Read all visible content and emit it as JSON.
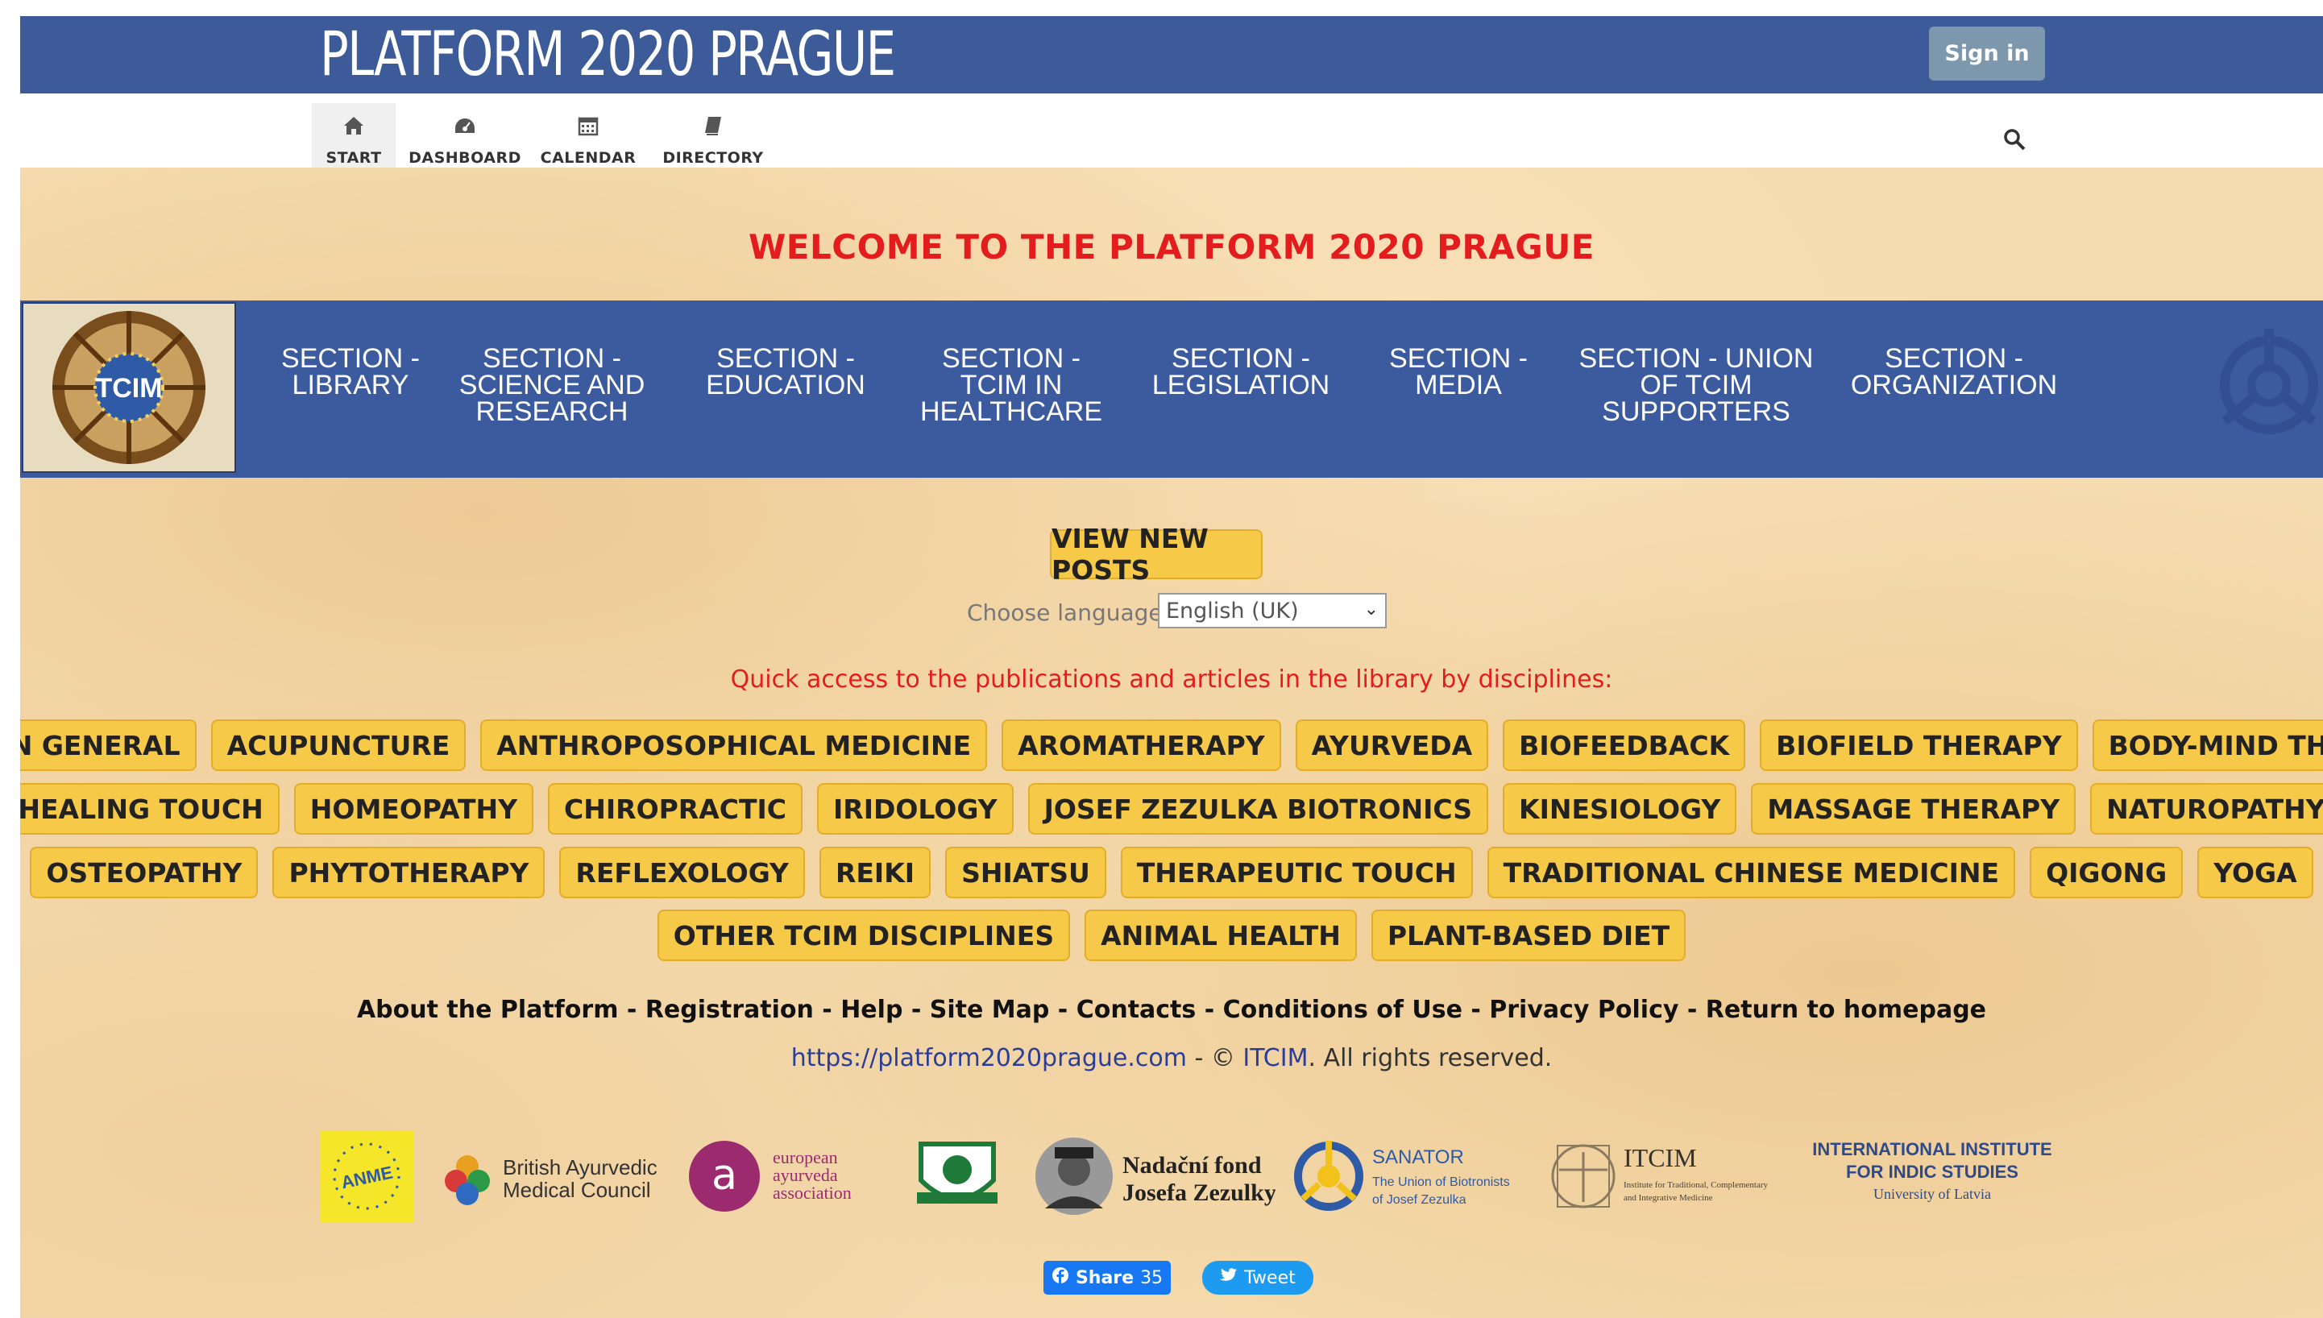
{
  "header": {
    "site_title": "PLATFORM 2020 PRAGUE",
    "signin_label": "Sign in"
  },
  "nav": {
    "items": [
      {
        "label": "START",
        "icon": "home-icon"
      },
      {
        "label": "DASHBOARD",
        "icon": "dashboard-icon"
      },
      {
        "label": "CALENDAR",
        "icon": "calendar-icon"
      },
      {
        "label": "DIRECTORY",
        "icon": "book-icon"
      }
    ],
    "active": "START"
  },
  "welcome": "WELCOME TO THE PLATFORM 2020 PRAGUE",
  "sections": [
    {
      "label": "SECTION - LIBRARY"
    },
    {
      "label": "SECTION - SCIENCE AND RESEARCH"
    },
    {
      "label": "SECTION - EDUCATION"
    },
    {
      "label": "SECTION - TCIM IN HEALTHCARE"
    },
    {
      "label": "SECTION - LEGISLATION"
    },
    {
      "label": "SECTION - MEDIA"
    },
    {
      "label": "SECTION - UNION OF TCIM SUPPORTERS"
    },
    {
      "label": "SECTION - ORGANIZATION"
    }
  ],
  "logo_text": "TCIM",
  "view_new_posts": "VIEW NEW POSTS",
  "language": {
    "label": "Choose language:",
    "selected": "English (UK)"
  },
  "quick_access": "Quick access to the publications and articles in the library by disciplines:",
  "disciplines": {
    "row1": [
      "TCIM IN GENERAL",
      "ACUPUNCTURE",
      "ANTHROPOSOPHICAL MEDICINE",
      "AROMATHERAPY",
      "AYURVEDA",
      "BIOFEEDBACK",
      "BIOFIELD THERAPY",
      "BODY-MIND THERAPY"
    ],
    "row2": [
      "HEALING TOUCH",
      "HOMEOPATHY",
      "CHIROPRACTIC",
      "IRIDOLOGY",
      "JOSEF ZEZULKA BIOTRONICS",
      "KINESIOLOGY",
      "MASSAGE THERAPY",
      "NATUROPATHY"
    ],
    "row3": [
      "OSTEOPATHY",
      "PHYTOTHERAPY",
      "REFLEXOLOGY",
      "REIKI",
      "SHIATSU",
      "THERAPEUTIC TOUCH",
      "TRADITIONAL CHINESE MEDICINE",
      "QIGONG",
      "YOGA"
    ],
    "row4": [
      "OTHER TCIM DISCIPLINES",
      "ANIMAL HEALTH",
      "PLANT-BASED DIET"
    ]
  },
  "footer": {
    "links": [
      "About the Platform",
      "Registration",
      "Help",
      "Site Map",
      "Contacts",
      "Conditions of Use",
      "Privacy Policy",
      "Return to homepage"
    ],
    "url": "https://platform2020prague.com",
    "copy_sep": " - © ",
    "org": "ITCIM",
    "rights": ". All rights reserved."
  },
  "partners": {
    "anme": "ANME",
    "bamc_1": "British Ayurvedic",
    "bamc_2": "Medical Council",
    "eaa_1": "european",
    "eaa_2": "ayurveda",
    "eaa_3": "association",
    "nf_1": "Nadační fond",
    "nf_2": "Josefa Zezulky",
    "sanator_1": "SANATOR",
    "sanator_2": "The Union of Biotronists",
    "sanator_3": "of Josef Zezulka",
    "itcim_1": "ITCIM",
    "itcim_2": "Institute for Traditional, Complementary",
    "itcim_3": "and Integrative Medicine",
    "iiis_1": "INTERNATIONAL INSTITUTE",
    "iiis_2": "FOR INDIC STUDIES",
    "iiis_3": "University of Latvia"
  },
  "social": {
    "share_label": "Share",
    "share_count": "35",
    "tweet_label": "Tweet"
  },
  "colors": {
    "header_blue": "#3d5b99",
    "welcome_red": "#e31d1d",
    "tag_yellow": "#f7c948"
  }
}
